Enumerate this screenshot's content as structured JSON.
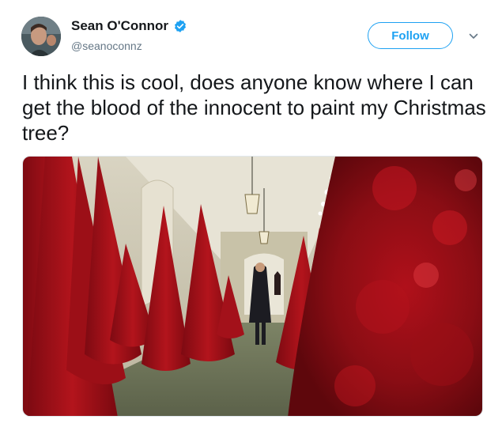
{
  "user": {
    "display_name": "Sean O'Connor",
    "handle": "@seanoconnz",
    "verified": true,
    "avatar_icon": "user-avatar"
  },
  "actions": {
    "follow_label": "Follow",
    "menu_icon": "chevron-down-icon"
  },
  "tweet": {
    "text": "I think this is cool, does anyone know where I can get the blood of the innocent to paint my Christmas tree?"
  },
  "media": {
    "icon": "photo-red-christmas-trees-hallway"
  },
  "colors": {
    "brand_blue": "#1da1f2",
    "handle_gray": "#657786",
    "text": "#14171a",
    "tree_red": "#a3111a"
  }
}
